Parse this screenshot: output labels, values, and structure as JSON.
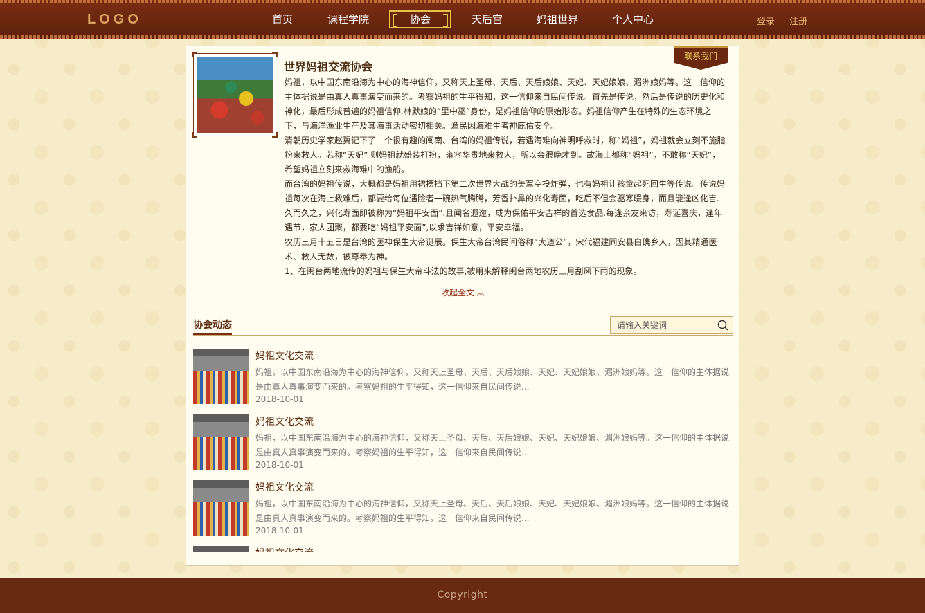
{
  "header": {
    "logo": "LOGO",
    "nav": [
      {
        "label": "首页",
        "active": false
      },
      {
        "label": "课程学院",
        "active": false
      },
      {
        "label": "协会",
        "active": true
      },
      {
        "label": "天后宫",
        "active": false
      },
      {
        "label": "妈祖世界",
        "active": false
      },
      {
        "label": "个人中心",
        "active": false
      }
    ],
    "login": "登录",
    "register": "注册"
  },
  "intro": {
    "contact": "联系我们",
    "title": "世界妈祖交流协会",
    "paragraphs": [
      "妈祖，以中国东南沿海为中心的海神信仰，又称天上圣母、天后、天后娘娘、天妃、天妃娘娘、湄洲娘妈等。这一信仰的主体据说是由真人真事演变而来的。考察妈祖的生平得知，这一信仰来自民间传说。首先是传说，然后是传说的历史化和神化，最后形成普遍的妈祖信仰.林默娘的“里中巫”身份，是妈祖信仰的原始形态。妈祖信仰产生在特殊的生态环境之下，与海洋渔业生产及其海事活动密切相关。渔民因海难生者神庇佑安全。",
      "清朝历史学家赵翼记下了一个很有趣的闽南、台湾的妈祖传说，若遇海难向神明呼救时，称“妈祖”，妈祖就会立刻不施脂粉来救人。若称“天妃” 则妈祖就盛装打扮，雍容华贵地来救人，所以会很晚才到。故海上都称“妈祖”，不敢称“天妃”，希望妈祖立刻来救海难中的渔船。",
      "而台湾的妈祖传说，大概都是妈祖用裙摆挡下第二次世界大战的美军空投炸弹，也有妈祖让孩童起死回生等传说。传说妈祖每次在海上救难后，都要给每位遇险者一碗热气腾腾，芳香扑鼻的兴化寿面，吃后不但会驱寒暖身，而且能逢凶化吉.久而久之，兴化寿面即被称为“妈祖平安面”.且闻名遐迩，成为保佑平安吉祥的首选食品.每逢亲友来访，寿诞喜庆，逢年遇节，家人团聚，都要吃“妈祖平安面”,以求吉祥如意，平安幸福。",
      "农历三月十五日是台湾的医神保生大帝诞辰。保生大帝台湾民间俗称“大道公”，宋代福建同安县白礁乡人，因其精通医术、救人无数，被尊奉为神。",
      "1、在闽台两地流传的妈祖与保生大帝斗法的故事,被用来解释闽台两地农历三月刮风下雨的现象。"
    ],
    "collapse_label": "收起全文"
  },
  "news": {
    "section_title": "协会动态",
    "search_placeholder": "请输入关键词",
    "items": [
      {
        "title": "妈祖文化交流",
        "summary": "妈祖，以中国东南沿海为中心的海神信仰，又称天上圣母、天后、天后娘娘、天妃、天妃娘娘、湄洲娘妈等。这一信仰的主体据说是由真人真事演变而来的。考察妈祖的生平得知，这一信仰来自民间传说...",
        "date": "2018-10-01"
      },
      {
        "title": "妈祖文化交流",
        "summary": "妈祖，以中国东南沿海为中心的海神信仰，又称天上圣母、天后、天后娘娘、天妃、天妃娘娘、湄洲娘妈等。这一信仰的主体据说是由真人真事演变而来的。考察妈祖的生平得知，这一信仰来自民间传说...",
        "date": "2018-10-01"
      },
      {
        "title": "妈祖文化交流",
        "summary": "妈祖，以中国东南沿海为中心的海神信仰，又称天上圣母、天后、天后娘娘、天妃、天妃娘娘、湄洲娘妈等。这一信仰的主体据说是由真人真事演变而来的。考察妈祖的生平得知，这一信仰来自民间传说...",
        "date": "2018-10-01"
      },
      {
        "title": "妈祖文化交流",
        "summary": "",
        "date": ""
      }
    ]
  },
  "footer": {
    "copyright": "Copyright"
  },
  "colors": {
    "header_bg": "#6a2912",
    "accent": "#e8c14a",
    "page_bg": "#f7ecc9"
  },
  "icons": {
    "search": "search-icon",
    "collapse": "chevron-up-icon"
  }
}
